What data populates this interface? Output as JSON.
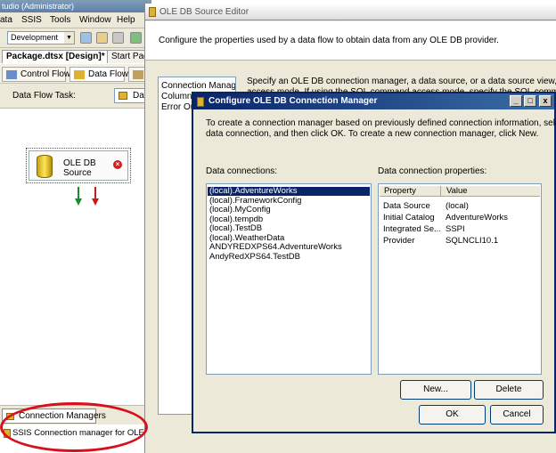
{
  "vs": {
    "title": "tudio (Administrator)",
    "menu": [
      "ata",
      "SSIS",
      "Tools",
      "Window",
      "Help"
    ],
    "configuration": "Development",
    "doc_tabs": [
      "Package.dtsx [Design]*",
      "Start Pag"
    ],
    "designer_tabs": [
      "Control Flow",
      "Data Flow"
    ],
    "data_flow_task_label": "Data Flow Task:",
    "data_flow_task_value": "Da",
    "component_label_line1": "OLE DB",
    "component_label_line2": "Source",
    "connection_managers_tab": "Connection Managers",
    "connection_manager_item": "SSIS Connection manager for OLE DB"
  },
  "ole_editor": {
    "title": "OLE DB Source Editor",
    "description": "Configure the properties used by a data flow to obtain data from any OLE DB provider.",
    "nav": [
      "Connection Manager",
      "Columns",
      "Error Ou"
    ],
    "right_text_line1": "Specify an OLE DB connection manager, a data source, or a data source view, and select",
    "right_text_line2": "access mode. If using the SQL command access mode, specify the SQL command either by"
  },
  "cfg": {
    "title": "Configure OLE DB Connection Manager",
    "description_line1": "To create a connection manager based on previously defined connection information, select a",
    "description_line2": "data connection, and then click OK. To create a new connection manager, click New.",
    "data_connections_label": "Data connections:",
    "data_connection_properties_label": "Data connection properties:",
    "connections": [
      "(local).AdventureWorks",
      "(local).FrameworkConfig",
      "(local).MyConfig",
      "(local).tempdb",
      "(local).TestDB",
      "(local).WeatherData",
      "ANDYREDXPS64.AdventureWorks",
      "AndyRedXPS64.TestDB"
    ],
    "selected_index": 0,
    "properties_header": {
      "property": "Property",
      "value": "Value"
    },
    "properties": [
      {
        "property": "Data Source",
        "value": "(local)"
      },
      {
        "property": "Initial Catalog",
        "value": "AdventureWorks"
      },
      {
        "property": "Integrated Se...",
        "value": "SSPI"
      },
      {
        "property": "Provider",
        "value": "SQLNCLI10.1"
      }
    ],
    "buttons": {
      "new": "New...",
      "delete": "Delete",
      "ok": "OK",
      "cancel": "Cancel"
    },
    "window_buttons": {
      "minimize": "_",
      "maximize": "□",
      "close": "x"
    }
  },
  "colors": {
    "highlight_ellipse": "#d8101c",
    "selection": "#0a246a",
    "title_bar": "#0a246a"
  }
}
